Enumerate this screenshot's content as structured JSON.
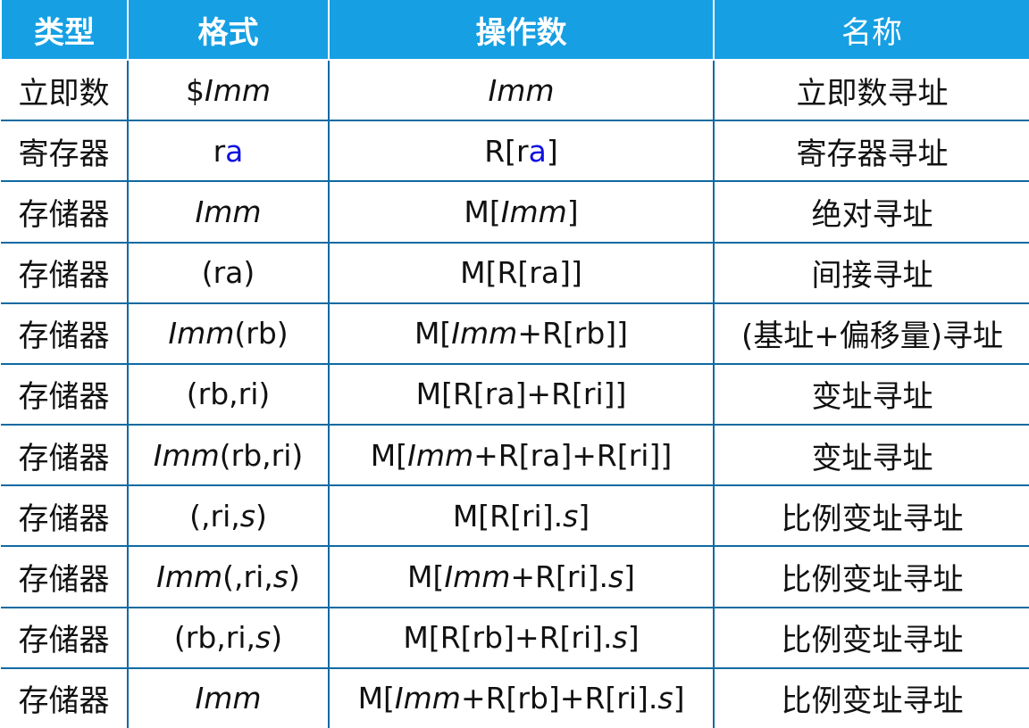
{
  "headers": [
    "类型",
    "格式",
    "操作数",
    "名称"
  ],
  "rows": [
    {
      "type": "立即数",
      "format": [
        {
          "t": "$"
        },
        {
          "t": "Imm",
          "i": true
        }
      ],
      "operand": [
        {
          "t": "Imm",
          "i": true
        }
      ],
      "name": "立即数寻址"
    },
    {
      "type": "寄存器",
      "format": [
        {
          "t": "r"
        },
        {
          "t": "a",
          "c": "#1010e0"
        }
      ],
      "operand": [
        {
          "t": "R[r"
        },
        {
          "t": "a",
          "c": "#1010e0"
        },
        {
          "t": "]"
        }
      ],
      "name": "寄存器寻址"
    },
    {
      "type": "存储器",
      "format": [
        {
          "t": "Imm",
          "i": true
        }
      ],
      "operand": [
        {
          "t": "M["
        },
        {
          "t": "Imm",
          "i": true
        },
        {
          "t": "]"
        }
      ],
      "name": "绝对寻址"
    },
    {
      "type": "存储器",
      "format": [
        {
          "t": "(ra)"
        }
      ],
      "operand": [
        {
          "t": "M[R[ra]]"
        }
      ],
      "name": "间接寻址"
    },
    {
      "type": "存储器",
      "format": [
        {
          "t": "Imm",
          "i": true
        },
        {
          "t": "(rb)"
        }
      ],
      "operand": [
        {
          "t": "M["
        },
        {
          "t": "Imm",
          "i": true
        },
        {
          "t": "+R[rb]]"
        }
      ],
      "name": "(基址+偏移量)寻址"
    },
    {
      "type": "存储器",
      "format": [
        {
          "t": "(rb,ri)"
        }
      ],
      "operand": [
        {
          "t": "M[R[ra]+R[ri]]"
        }
      ],
      "name": "变址寻址"
    },
    {
      "type": "存储器",
      "format": [
        {
          "t": "Imm",
          "i": true
        },
        {
          "t": "(rb,ri)"
        }
      ],
      "operand": [
        {
          "t": "M["
        },
        {
          "t": "Imm",
          "i": true
        },
        {
          "t": "+R[ra]+R[ri]]"
        }
      ],
      "name": "变址寻址"
    },
    {
      "type": "存储器",
      "format": [
        {
          "t": "(,ri,"
        },
        {
          "t": "s",
          "i": true
        },
        {
          "t": ")"
        }
      ],
      "operand": [
        {
          "t": "M[R[ri]."
        },
        {
          "t": "s",
          "i": true
        },
        {
          "t": "]"
        }
      ],
      "name": "比例变址寻址"
    },
    {
      "type": "存储器",
      "format": [
        {
          "t": "Imm",
          "i": true
        },
        {
          "t": "(,ri,"
        },
        {
          "t": "s",
          "i": true
        },
        {
          "t": ")"
        }
      ],
      "operand": [
        {
          "t": "M["
        },
        {
          "t": "Imm",
          "i": true
        },
        {
          "t": "+R[ri]."
        },
        {
          "t": "s",
          "i": true
        },
        {
          "t": "]"
        }
      ],
      "name": "比例变址寻址"
    },
    {
      "type": "存储器",
      "format": [
        {
          "t": "(rb,ri,"
        },
        {
          "t": "s",
          "i": true
        },
        {
          "t": ")"
        }
      ],
      "operand": [
        {
          "t": "M[R[rb]+R[ri]."
        },
        {
          "t": "s",
          "i": true
        },
        {
          "t": "]"
        }
      ],
      "name": "比例变址寻址"
    },
    {
      "type": "存储器",
      "format": [
        {
          "t": "Imm",
          "i": true
        }
      ],
      "operand": [
        {
          "t": "M["
        },
        {
          "t": "Imm",
          "i": true
        },
        {
          "t": "+R[rb]+R[ri]."
        },
        {
          "t": "s",
          "i": true
        },
        {
          "t": "]"
        }
      ],
      "name": "比例变址寻址"
    }
  ]
}
